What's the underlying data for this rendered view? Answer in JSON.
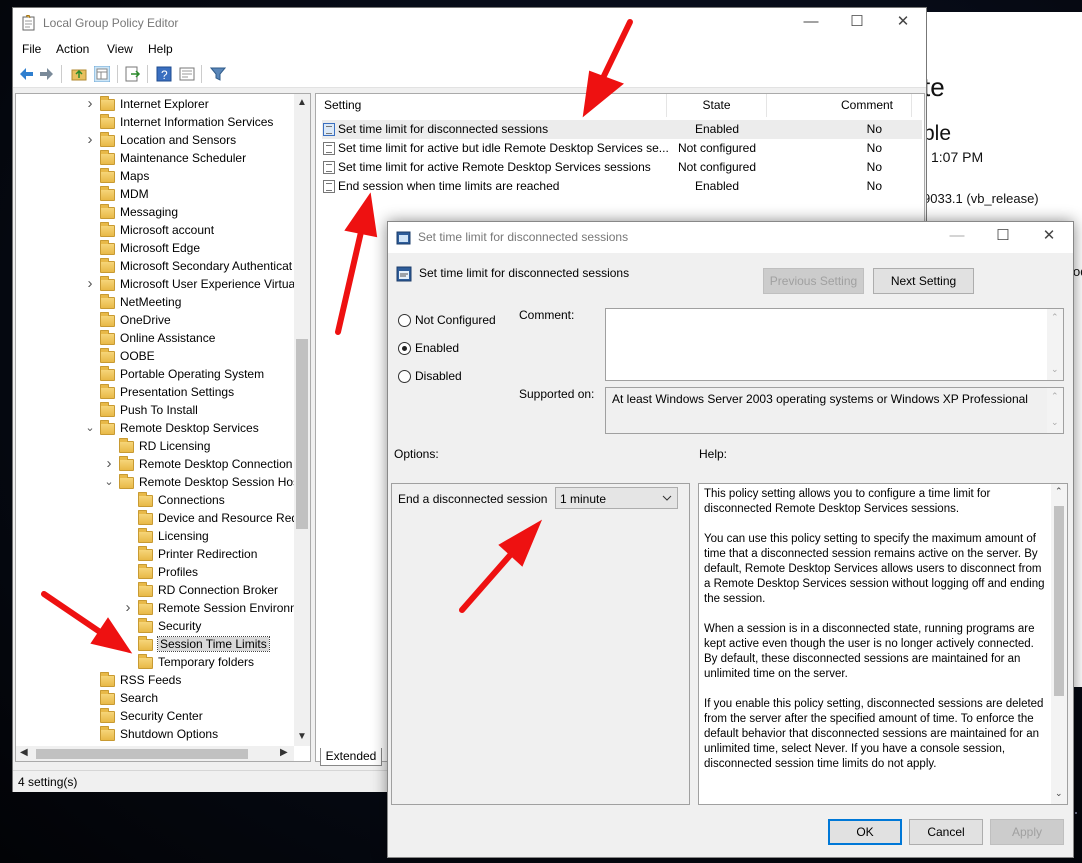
{
  "background_window": {
    "frag_title": "te",
    "frag_sub": "ble",
    "frag_time": "1:07 PM",
    "frag_build": "9033.1 (vb_release)",
    "frag_side": "od"
  },
  "main_window": {
    "title": "Local Group Policy Editor",
    "menu": [
      "File",
      "Action",
      "View",
      "Help"
    ],
    "status": "4 setting(s)",
    "tree": [
      {
        "label": "Internet Explorer",
        "level": 0,
        "expander": "right"
      },
      {
        "label": "Internet Information Services",
        "level": 0,
        "expander": ""
      },
      {
        "label": "Location and Sensors",
        "level": 0,
        "expander": "right"
      },
      {
        "label": "Maintenance Scheduler",
        "level": 0,
        "expander": ""
      },
      {
        "label": "Maps",
        "level": 0,
        "expander": ""
      },
      {
        "label": "MDM",
        "level": 0,
        "expander": ""
      },
      {
        "label": "Messaging",
        "level": 0,
        "expander": ""
      },
      {
        "label": "Microsoft account",
        "level": 0,
        "expander": ""
      },
      {
        "label": "Microsoft Edge",
        "level": 0,
        "expander": ""
      },
      {
        "label": "Microsoft Secondary Authenticat",
        "level": 0,
        "expander": ""
      },
      {
        "label": "Microsoft User Experience Virtual",
        "level": 0,
        "expander": "right"
      },
      {
        "label": "NetMeeting",
        "level": 0,
        "expander": ""
      },
      {
        "label": "OneDrive",
        "level": 0,
        "expander": ""
      },
      {
        "label": "Online Assistance",
        "level": 0,
        "expander": ""
      },
      {
        "label": "OOBE",
        "level": 0,
        "expander": ""
      },
      {
        "label": "Portable Operating System",
        "level": 0,
        "expander": ""
      },
      {
        "label": "Presentation Settings",
        "level": 0,
        "expander": ""
      },
      {
        "label": "Push To Install",
        "level": 0,
        "expander": ""
      },
      {
        "label": "Remote Desktop Services",
        "level": 0,
        "expander": "down"
      },
      {
        "label": "RD Licensing",
        "level": 1,
        "expander": ""
      },
      {
        "label": "Remote Desktop Connection",
        "level": 1,
        "expander": "right"
      },
      {
        "label": "Remote Desktop Session Host",
        "level": 1,
        "expander": "down"
      },
      {
        "label": "Connections",
        "level": 2,
        "expander": ""
      },
      {
        "label": "Device and Resource Redi",
        "level": 2,
        "expander": ""
      },
      {
        "label": "Licensing",
        "level": 2,
        "expander": ""
      },
      {
        "label": "Printer Redirection",
        "level": 2,
        "expander": ""
      },
      {
        "label": "Profiles",
        "level": 2,
        "expander": ""
      },
      {
        "label": "RD Connection Broker",
        "level": 2,
        "expander": ""
      },
      {
        "label": "Remote Session Environm",
        "level": 2,
        "expander": "right"
      },
      {
        "label": "Security",
        "level": 2,
        "expander": ""
      },
      {
        "label": "Session Time Limits",
        "level": 2,
        "expander": "",
        "selected": true
      },
      {
        "label": "Temporary folders",
        "level": 2,
        "expander": ""
      },
      {
        "label": "RSS Feeds",
        "level": 0,
        "expander": ""
      },
      {
        "label": "Search",
        "level": 0,
        "expander": ""
      },
      {
        "label": "Security Center",
        "level": 0,
        "expander": ""
      },
      {
        "label": "Shutdown Options",
        "level": 0,
        "expander": ""
      }
    ],
    "columns": {
      "setting": "Setting",
      "state": "State",
      "comment": "Comment"
    },
    "rows": [
      {
        "setting": "Set time limit for disconnected sessions",
        "state": "Enabled",
        "comment": "No",
        "highlighted": true
      },
      {
        "setting": "Set time limit for active but idle Remote Desktop Services se...",
        "state": "Not configured",
        "comment": "No"
      },
      {
        "setting": "Set time limit for active Remote Desktop Services sessions",
        "state": "Not configured",
        "comment": "No"
      },
      {
        "setting": "End session when time limits are reached",
        "state": "Enabled",
        "comment": "No"
      }
    ],
    "bottom_tab": "Extended"
  },
  "dialog": {
    "title": "Set time limit for disconnected sessions",
    "heading": "Set time limit for disconnected sessions",
    "prev_button": "Previous Setting",
    "next_button": "Next Setting",
    "radio_not_configured": "Not Configured",
    "radio_enabled": "Enabled",
    "radio_disabled": "Disabled",
    "comment_label": "Comment:",
    "supported_label": "Supported on:",
    "supported_value": "At least Windows Server 2003 operating systems or Windows XP Professional",
    "options_label": "Options:",
    "help_label": "Help:",
    "option_field_label": "End a disconnected session",
    "option_field_value": "1 minute",
    "help_paragraphs": [
      "This policy setting allows you to configure a time limit for disconnected Remote Desktop Services sessions.",
      "You can use this policy setting to specify the maximum amount of time that a disconnected session remains active on the server. By default, Remote Desktop Services allows users to disconnect from a Remote Desktop Services session without logging off and ending the session.",
      "When a session is in a disconnected state, running programs are kept active even though the user is no longer actively connected. By default, these disconnected sessions are maintained for an unlimited time on the server.",
      "If you enable this policy setting, disconnected sessions are deleted from the server after the specified amount of time. To enforce the default behavior that disconnected sessions are maintained for an unlimited time, select Never. If you have a console session, disconnected session time limits do not apply."
    ],
    "ok": "OK",
    "cancel": "Cancel",
    "apply": "Apply"
  },
  "colors": {
    "accent": "#0078d7",
    "arrow": "#ee1111",
    "selection": "#d9d9d9"
  }
}
